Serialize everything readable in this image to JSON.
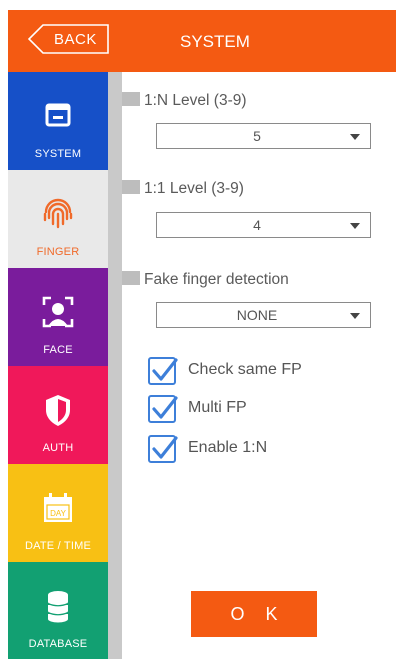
{
  "header": {
    "back_label": "BACK",
    "title": "SYSTEM"
  },
  "sidebar": {
    "items": [
      {
        "label": "SYSTEM",
        "icon": "window-icon",
        "color": "#1650c8",
        "active": false
      },
      {
        "label": "FINGER",
        "icon": "fingerprint-icon",
        "color": "#e9e9e9",
        "active": true
      },
      {
        "label": "FACE",
        "icon": "face-scan-icon",
        "color": "#7a1c9c",
        "active": false
      },
      {
        "label": "AUTH",
        "icon": "shield-icon",
        "color": "#f0185a",
        "active": false
      },
      {
        "label": "DATE / TIME",
        "icon": "calendar-icon",
        "color": "#f8c014",
        "active": false
      },
      {
        "label": "DATABASE",
        "icon": "database-icon",
        "color": "#12a072",
        "active": false
      }
    ],
    "calendar_text": "DAY"
  },
  "settings": {
    "level_1n": {
      "label": "1:N Level (3-9)",
      "value": "5"
    },
    "level_11": {
      "label": "1:1 Level (3-9)",
      "value": "4"
    },
    "fake_finger": {
      "label": "Fake finger detection",
      "value": "NONE"
    }
  },
  "checkboxes": [
    {
      "label": "Check same FP",
      "checked": true
    },
    {
      "label": "Multi FP",
      "checked": true
    },
    {
      "label": "Enable 1:N",
      "checked": true
    }
  ],
  "ok_label": "O K",
  "colors": {
    "accent": "#f45a12",
    "check_blue": "#3d7fd9",
    "finger_active": "#f06a2a"
  }
}
